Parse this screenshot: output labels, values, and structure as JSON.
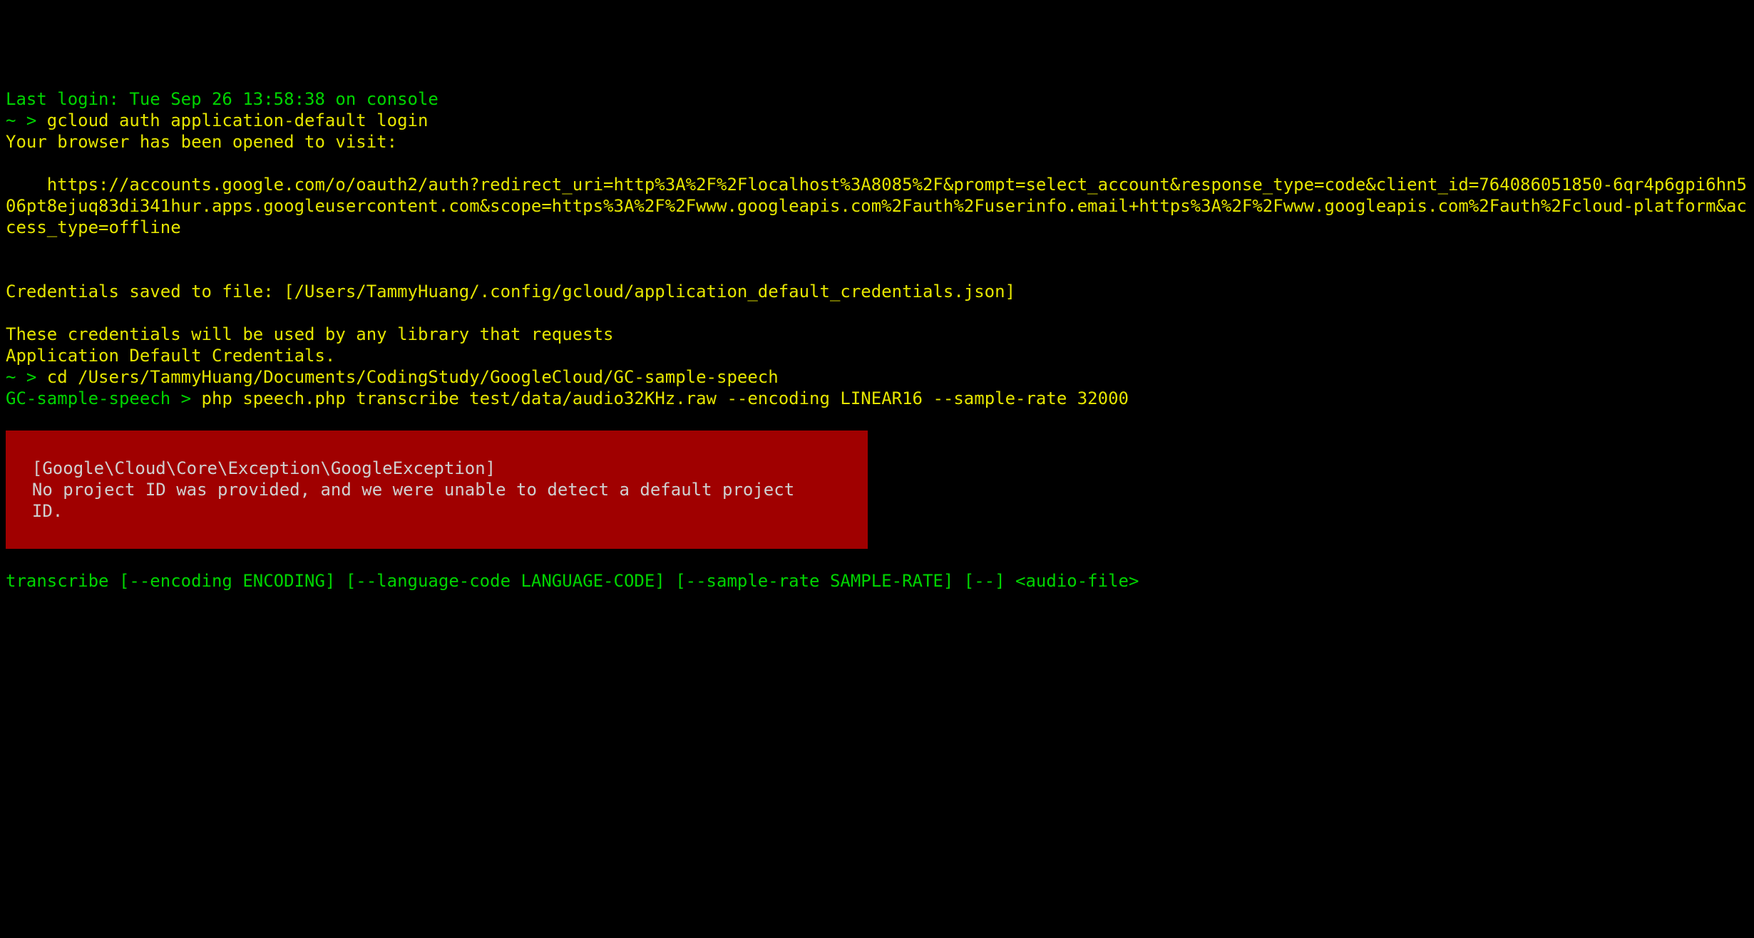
{
  "lines": {
    "lastLogin": "Last login: Tue Sep 26 13:58:38 on console",
    "prompt1": "~ > ",
    "cmd1": "gcloud auth application-default login",
    "browserMsg": "Your browser has been opened to visit:",
    "oauthUrl": "    https://accounts.google.com/o/oauth2/auth?redirect_uri=http%3A%2F%2Flocalhost%3A8085%2F&prompt=select_account&response_type=code&client_id=764086051850-6qr4p6gpi6hn506pt8ejuq83di341hur.apps.googleusercontent.com&scope=https%3A%2F%2Fwww.googleapis.com%2Fauth%2Fuserinfo.email+https%3A%2F%2Fwww.googleapis.com%2Fauth%2Fcloud-platform&access_type=offline",
    "credentialsSaved": "Credentials saved to file: [/Users/TammyHuang/.config/gcloud/application_default_credentials.json]",
    "credMsg1": "These credentials will be used by any library that requests",
    "credMsg2": "Application Default Credentials.",
    "prompt2": "~ > ",
    "cmd2": "cd /Users/TammyHuang/Documents/CodingStudy/GoogleCloud/GC-sample-speech",
    "prompt3": "GC-sample-speech > ",
    "cmd3": "php speech.php transcribe test/data/audio32KHz.raw --encoding LINEAR16 --sample-rate 32000",
    "errorTitle": "  [Google\\Cloud\\Core\\Exception\\GoogleException]",
    "errorBody": "  No project ID was provided, and we were unable to detect a default project\n  ID.",
    "usage": "transcribe [--encoding ENCODING] [--language-code LANGUAGE-CODE] [--sample-rate SAMPLE-RATE] [--] <audio-file>"
  }
}
